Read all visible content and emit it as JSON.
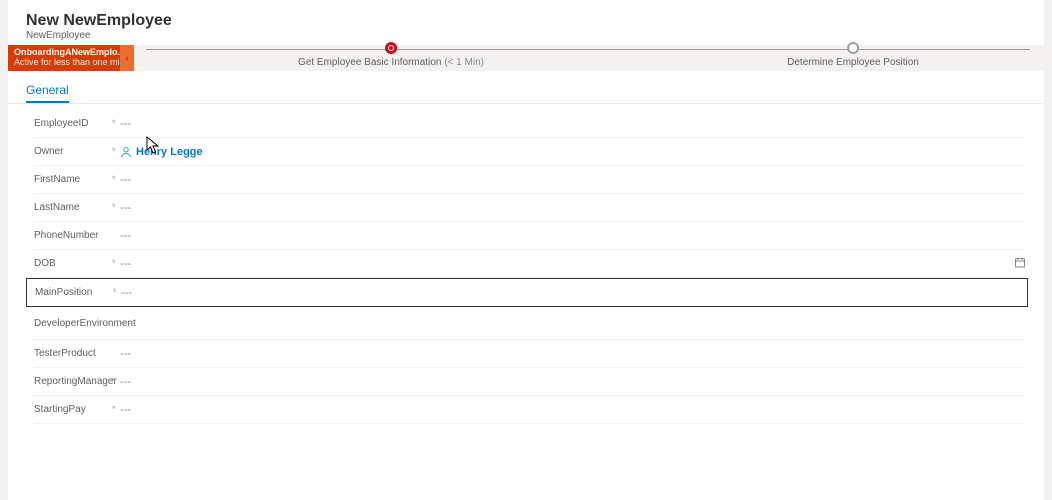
{
  "header": {
    "title": "New NewEmployee",
    "subtitle": "NewEmployee"
  },
  "bpf": {
    "flow_name": "OnboardingANewEmplo...",
    "flow_status": "Active for less than one mi...",
    "stages": [
      {
        "label": "Get Employee Basic Information",
        "time": "(< 1 Min)",
        "active": true
      },
      {
        "label": "Determine Employee Position",
        "time": "",
        "active": false
      }
    ]
  },
  "tabs": {
    "general": "General"
  },
  "form": {
    "placeholder": "---",
    "fields": {
      "employee_id": {
        "label": "EmployeeID",
        "required": true
      },
      "owner": {
        "label": "Owner",
        "required": true,
        "value_name": "Henry Legge"
      },
      "first_name": {
        "label": "FirstName",
        "required": true
      },
      "last_name": {
        "label": "LastName",
        "required": true
      },
      "phone_number": {
        "label": "PhoneNumber",
        "required": false
      },
      "dob": {
        "label": "DOB",
        "required": true
      },
      "main_position": {
        "label": "MainPosition",
        "required": true
      },
      "developer_environment": {
        "label": "DeveloperEnvironment",
        "required": false
      },
      "tester_product": {
        "label": "TesterProduct",
        "required": false
      },
      "reporting_manager": {
        "label": "ReportingManager",
        "required": true
      },
      "starting_pay": {
        "label": "StartingPay",
        "required": true
      }
    }
  }
}
